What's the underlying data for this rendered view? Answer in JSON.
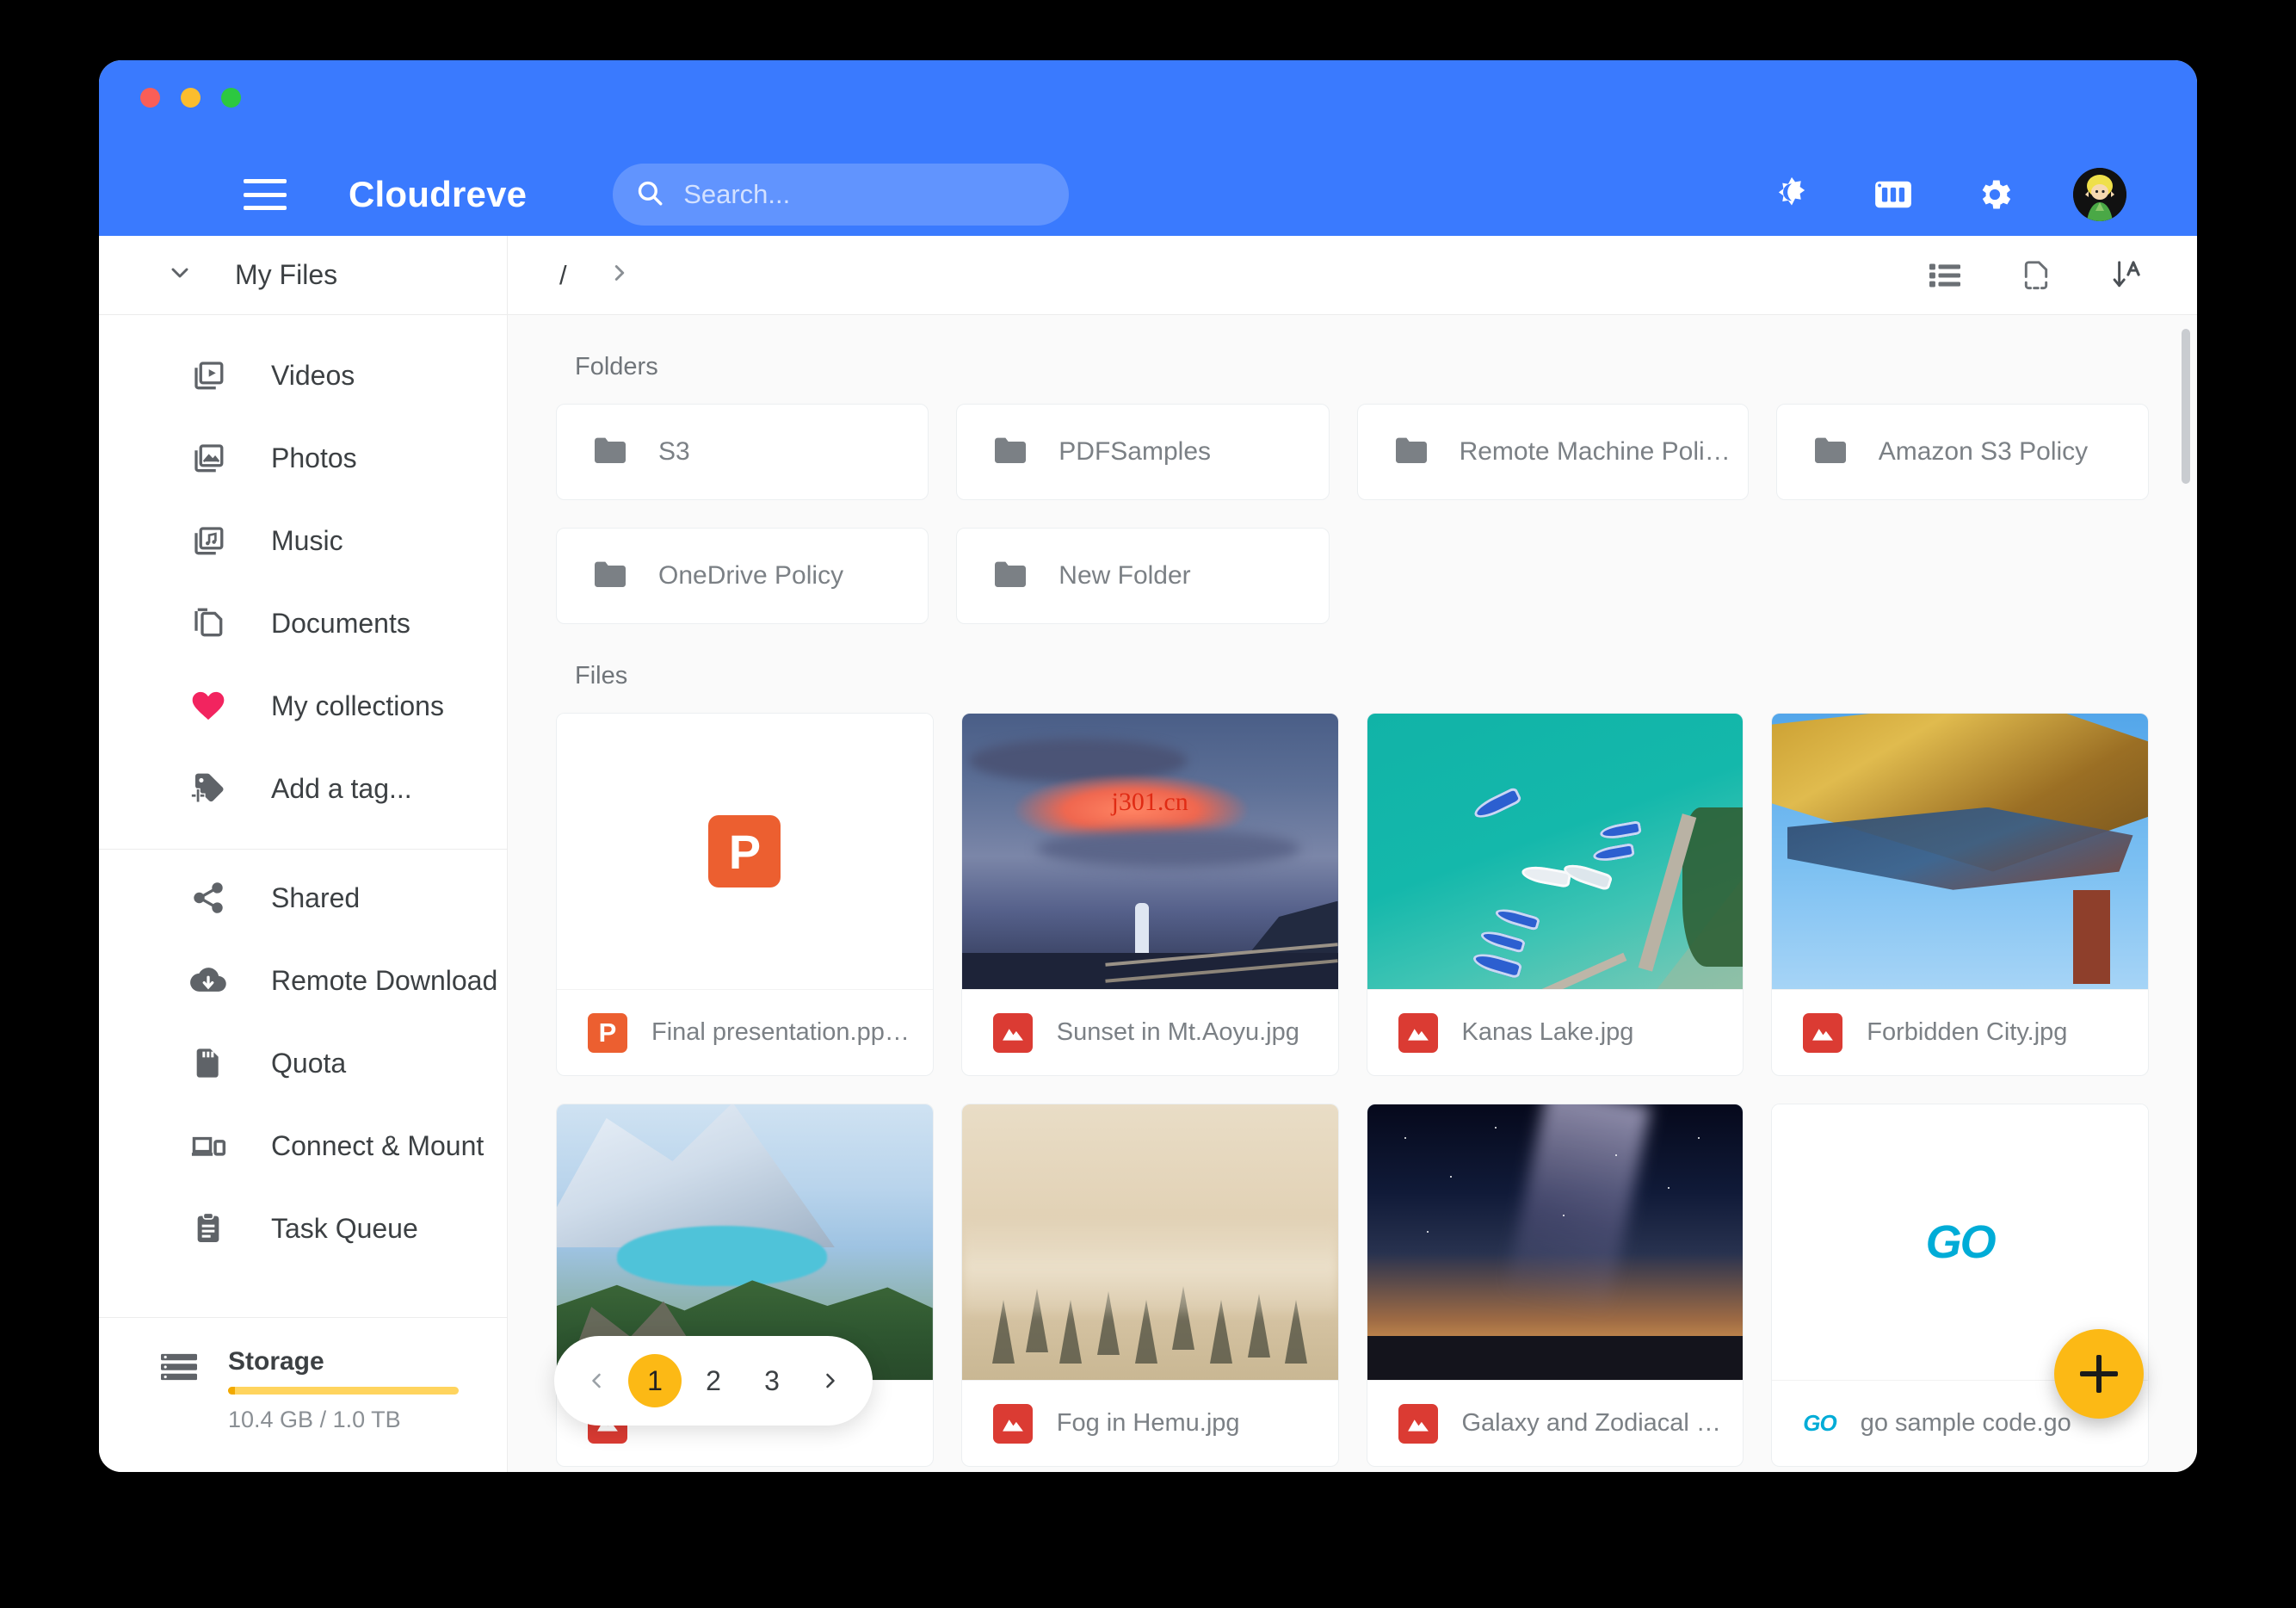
{
  "window": {
    "traffic_lights": [
      "close",
      "minimize",
      "maximize"
    ]
  },
  "appbar": {
    "brand": "Cloudreve",
    "menu_icon": "hamburger-icon",
    "search": {
      "placeholder": "Search...",
      "value": "",
      "icon": "search-icon"
    },
    "actions": [
      {
        "name": "dark-mode-toggle",
        "icon": "brightness-icon"
      },
      {
        "name": "task-storage-button",
        "icon": "storage-icon"
      },
      {
        "name": "settings-button",
        "icon": "gear-icon"
      },
      {
        "name": "user-avatar",
        "icon": "avatar-icon"
      }
    ]
  },
  "sidebar": {
    "root": {
      "label": "My Files",
      "expanded": true,
      "chevron": "chevron-down-icon"
    },
    "items": [
      {
        "label": "Videos",
        "icon": "video-library-icon"
      },
      {
        "label": "Photos",
        "icon": "photo-library-icon"
      },
      {
        "label": "Music",
        "icon": "music-library-icon"
      },
      {
        "label": "Documents",
        "icon": "documents-icon"
      },
      {
        "label": "My collections",
        "icon": "heart-icon",
        "color": "#f2245f"
      },
      {
        "label": "Add a tag...",
        "icon": "add-tag-icon"
      }
    ],
    "tools": [
      {
        "label": "Shared",
        "icon": "share-icon"
      },
      {
        "label": "Remote Download",
        "icon": "cloud-download-icon"
      },
      {
        "label": "Quota",
        "icon": "sd-card-icon"
      },
      {
        "label": "Connect & Mount",
        "icon": "devices-icon"
      },
      {
        "label": "Task Queue",
        "icon": "clipboard-icon"
      }
    ],
    "storage": {
      "title": "Storage",
      "usage_text": "10.4 GB / 1.0 TB",
      "used_percent": 1,
      "bar_color": "#ffd45e",
      "icon": "storage-rows-icon"
    }
  },
  "toolbar": {
    "breadcrumb": [
      "/"
    ],
    "breadcrumb_expand_icon": "chevron-right-icon",
    "actions": [
      {
        "name": "list-view-toggle",
        "icon": "list-view-icon"
      },
      {
        "name": "select-file-button",
        "icon": "file-dashed-icon"
      },
      {
        "name": "sort-button",
        "icon": "sort-az-icon"
      }
    ]
  },
  "main": {
    "folders_label": "Folders",
    "files_label": "Files",
    "folders": [
      {
        "name": "S3",
        "icon": "folder-icon"
      },
      {
        "name": "PDFSamples",
        "icon": "folder-icon"
      },
      {
        "name": "Remote Machine Poli…",
        "icon": "folder-icon"
      },
      {
        "name": "Amazon S3 Policy",
        "icon": "folder-icon"
      },
      {
        "name": "OneDrive Policy",
        "icon": "folder-icon"
      },
      {
        "name": "New Folder",
        "icon": "folder-icon"
      }
    ],
    "files": [
      {
        "name": "Final presentation.pp…",
        "icon": "powerpoint-icon",
        "badge": "P",
        "badge_color": "#ec5f30",
        "thumb": "powerpoint"
      },
      {
        "name": "Sunset in Mt.Aoyu.jpg",
        "icon": "image-icon",
        "badge_color": "#db3b33",
        "thumb": "sunset",
        "watermark": "j301.cn"
      },
      {
        "name": "Kanas Lake.jpg",
        "icon": "image-icon",
        "badge_color": "#db3b33",
        "thumb": "kanas"
      },
      {
        "name": "Forbidden City.jpg",
        "icon": "image-icon",
        "badge_color": "#db3b33",
        "thumb": "forbidden"
      },
      {
        "name": "",
        "icon": "image-icon",
        "badge_color": "#db3b33",
        "thumb": "mountain"
      },
      {
        "name": "Fog in Hemu.jpg",
        "icon": "image-icon",
        "badge_color": "#db3b33",
        "thumb": "fog"
      },
      {
        "name": "Galaxy and Zodiacal …",
        "icon": "image-icon",
        "badge_color": "#db3b33",
        "thumb": "galaxy"
      },
      {
        "name": "go sample code.go",
        "icon": "go-icon",
        "thumb": "go"
      }
    ]
  },
  "pagination": {
    "prev_icon": "chevron-left-icon",
    "next_icon": "chevron-right-icon",
    "pages": [
      "1",
      "2",
      "3"
    ],
    "current": "1",
    "active_color": "#fcb915"
  },
  "fab": {
    "label": "+",
    "name": "add-button",
    "color": "#fcb915"
  },
  "colors": {
    "appbar": "#3a7afe",
    "accent": "#fcb915",
    "heart": "#f2245f"
  }
}
